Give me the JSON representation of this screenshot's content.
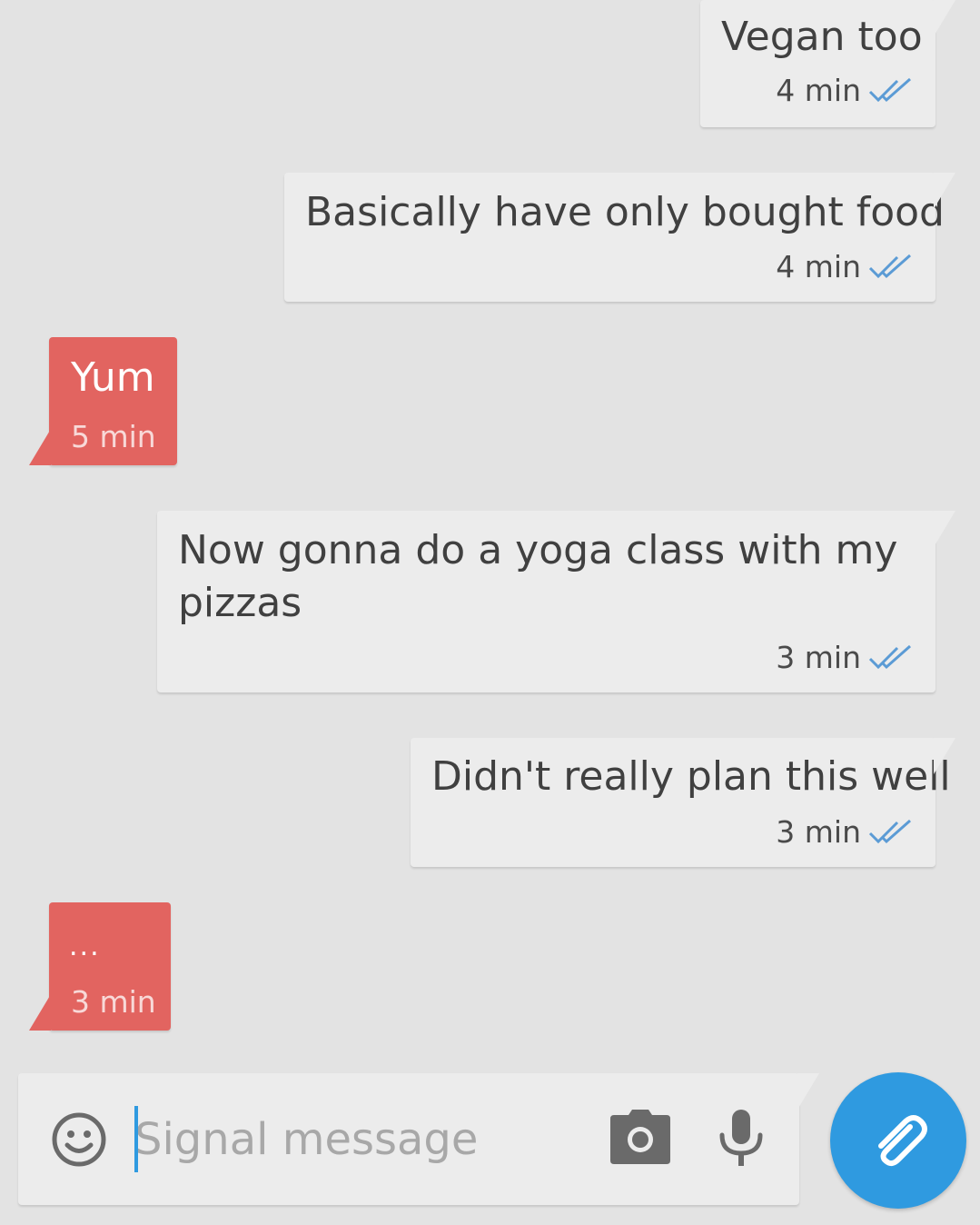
{
  "colors": {
    "background": "#e3e3e3",
    "outgoing_bubble": "#ececec",
    "incoming_bubble": "#e26460",
    "accent": "#2f9ae0",
    "delivered_check": "#5b9bd5"
  },
  "messages": [
    {
      "direction": "outgoing",
      "text": "Vegan too",
      "time": "4 min",
      "status_icon": "double-check-icon"
    },
    {
      "direction": "outgoing",
      "text": "Basically have only bought food",
      "time": "4 min",
      "status_icon": "double-check-icon"
    },
    {
      "direction": "incoming",
      "text": "Yum",
      "time": "5 min"
    },
    {
      "direction": "outgoing",
      "text_line1": "Now gonna do a yoga class with my",
      "text_line2": "pizzas",
      "time": "3 min",
      "status_icon": "double-check-icon"
    },
    {
      "direction": "outgoing",
      "text": "Didn't really plan this well",
      "time": "3 min",
      "status_icon": "double-check-icon"
    },
    {
      "direction": "incoming",
      "text": "...",
      "time": "3 min"
    }
  ],
  "composer": {
    "placeholder": "Signal message",
    "value": "",
    "emoji_icon": "emoji-icon",
    "camera_icon": "camera-icon",
    "mic_icon": "microphone-icon",
    "attach_icon": "paperclip-icon"
  }
}
